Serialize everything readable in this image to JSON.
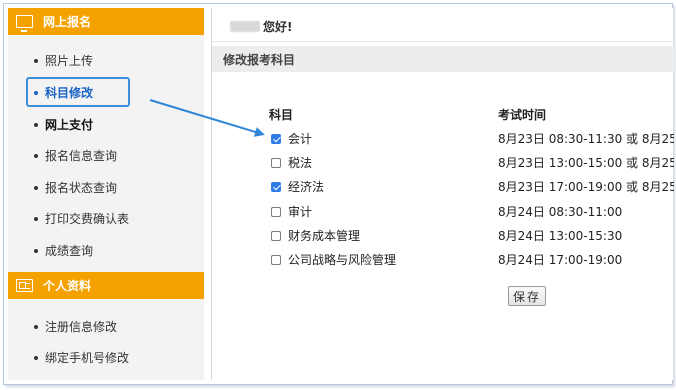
{
  "sidebar": {
    "section1": {
      "title": "网上报名",
      "icon": "monitor-icon"
    },
    "items1": [
      {
        "label": "照片上传"
      },
      {
        "label": "科目修改"
      },
      {
        "label": "网上支付"
      },
      {
        "label": "报名信息查询"
      },
      {
        "label": "报名状态查询"
      },
      {
        "label": "打印交费确认表"
      },
      {
        "label": "成绩查询"
      }
    ],
    "section2": {
      "title": "个人资料",
      "icon": "id-card-icon"
    },
    "items2": [
      {
        "label": "注册信息修改"
      },
      {
        "label": "绑定手机号修改"
      }
    ]
  },
  "main": {
    "greeting": "您好!",
    "panel_title": "修改报考科目",
    "table": {
      "col_subject": "科目",
      "col_time": "考试时间",
      "rows": [
        {
          "subject": "会计",
          "checked": true,
          "time": "8月23日  08:30-11:30  或  8月25日"
        },
        {
          "subject": "税法",
          "checked": false,
          "time": "8月23日  13:00-15:00  或  8月25日"
        },
        {
          "subject": "经济法",
          "checked": true,
          "time": "8月23日  17:00-19:00  或  8月25日"
        },
        {
          "subject": "审计",
          "checked": false,
          "time": "8月24日  08:30-11:00"
        },
        {
          "subject": "财务成本管理",
          "checked": false,
          "time": "8月24日  13:00-15:30"
        },
        {
          "subject": "公司战略与风险管理",
          "checked": false,
          "time": "8月24日  17:00-19:00"
        }
      ]
    },
    "save_label": "保存"
  },
  "colors": {
    "accent": "#f5a100",
    "link": "#1a63c7",
    "checkbox": "#2f7ee8"
  }
}
